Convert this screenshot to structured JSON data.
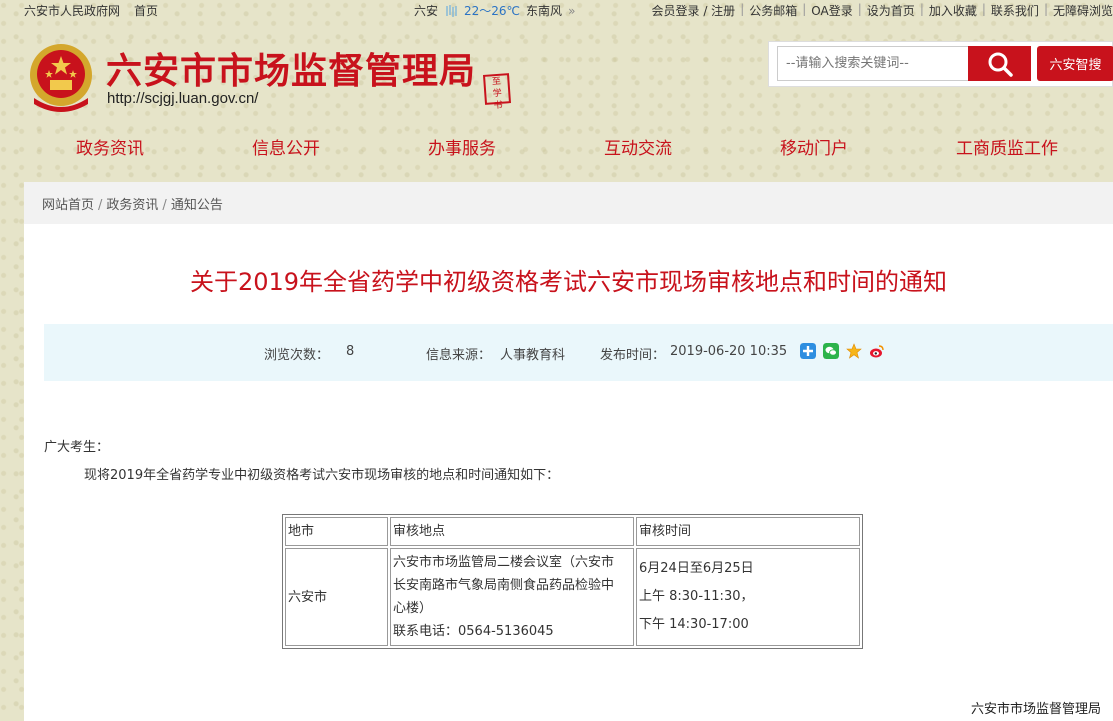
{
  "topbar": {
    "gov_site": "六安市人民政府网",
    "home": "首页",
    "city": "六安",
    "temp": "22～26℃",
    "wind": "东南风",
    "more": "»",
    "links": [
      "会员登录 / 注册",
      "公务邮箱",
      "OA登录",
      "设为首页",
      "加入收藏",
      "联系我们",
      "无障碍浏览"
    ]
  },
  "header": {
    "title": "六安市市场监督管理局",
    "url": "http://scjgj.luan.gov.cn/",
    "seal_text": "至\n学\n书",
    "search_placeholder": "--请输入搜索关键词--",
    "zhiso_label": "六安智搜"
  },
  "nav": [
    "政务资讯",
    "信息公开",
    "办事服务",
    "互动交流",
    "移动门户",
    "工商质监工作"
  ],
  "breadcrumb": [
    "网站首页",
    "政务资讯",
    "通知公告"
  ],
  "article": {
    "title": "关于2019年全省药学中初级资格考试六安市现场审核地点和时间的通知",
    "views_label": "浏览次数：",
    "views": "8",
    "source_label": "信息来源：",
    "source": "人事教育科",
    "time_label": "发布时间：",
    "time": "2019-06-20 10:35",
    "greeting": "广大考生：",
    "intro": "现将2019年全省药学专业中初级资格考试六安市现场审核的地点和时间通知如下：",
    "table": {
      "headers": [
        "地市",
        "审核地点",
        "审核时间"
      ],
      "row": {
        "city": "六安市",
        "place_lines": [
          "六安市市场监管局二楼会议室（六安市",
          "长安南路市气象局南侧食品药品检验中",
          "心楼）",
          "联系电话：0564-5136045"
        ],
        "time_lines": [
          "6月24日至6月25日",
          "上午 8:30-11:30，",
          "下午 14:30-17:00"
        ]
      }
    },
    "signature": "六安市市场监督管理局"
  },
  "colors": {
    "brand_red": "#c8121c",
    "meta_bg": "#eaf7fb",
    "temp_blue": "#2b73c4"
  }
}
